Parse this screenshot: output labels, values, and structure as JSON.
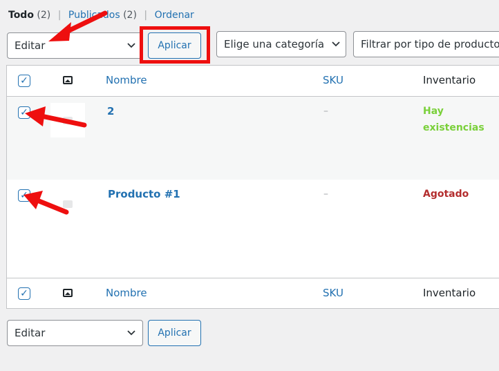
{
  "filters": {
    "all_label": "Todo",
    "all_count": "(2)",
    "published_label": "Publicados",
    "published_count": "(2)",
    "sort_label": "Ordenar",
    "separator": "|"
  },
  "bulk_top": {
    "select_value": "Editar",
    "apply_label": "Aplicar"
  },
  "category_select": {
    "value": "Elige una categoría"
  },
  "type_select": {
    "value": "Filtrar por tipo de producto"
  },
  "table": {
    "columns": {
      "name": "Nombre",
      "sku": "SKU",
      "stock": "Inventario"
    },
    "rows": [
      {
        "name": "2",
        "sku": "–",
        "stock_line1": "Hay",
        "stock_line2": "existencias",
        "stock_color": "#7ad03a",
        "checked": true
      },
      {
        "name": "Producto #1",
        "sku": "–",
        "stock_line1": "Agotado",
        "stock_line2": "",
        "stock_color": "#b32d2e",
        "checked": true
      }
    ]
  },
  "bulk_bottom": {
    "select_value": "Editar",
    "apply_label": "Aplicar"
  },
  "icons": {
    "checkbox": "✓",
    "chevron": "chevron-down-icon",
    "image": "image-icon"
  },
  "colors": {
    "link": "#2271b1",
    "annotation": "#ee0f0f"
  }
}
